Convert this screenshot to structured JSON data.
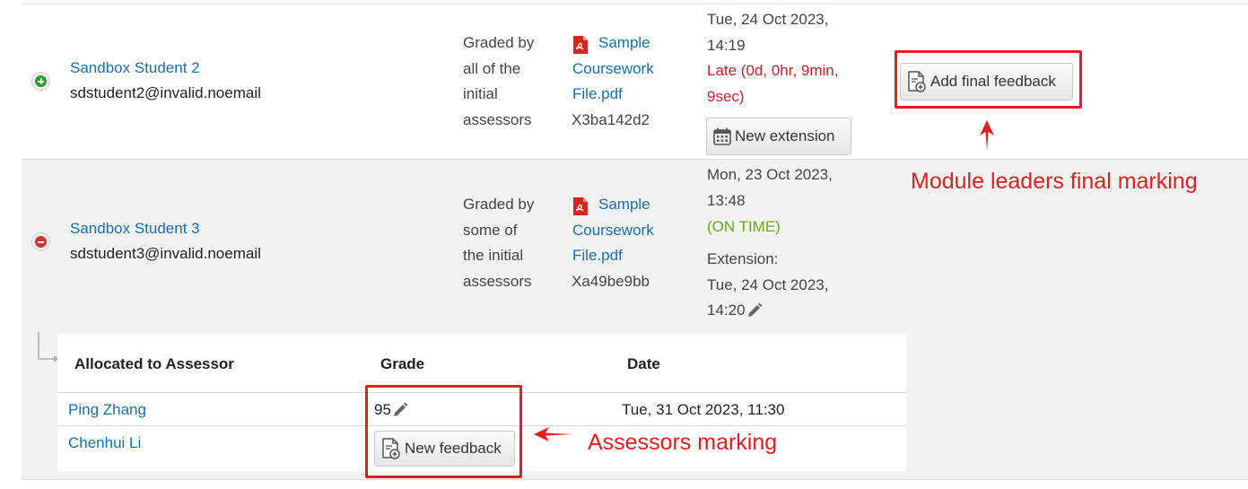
{
  "colors": {
    "link": "#1a6ea8",
    "late": "#c0242a",
    "on_time": "#6aa424",
    "annotation": "#e02020"
  },
  "rows": [
    {
      "toggle_icon": "expand-plus-icon",
      "student_name": "Sandbox Student 2",
      "student_email": "sdstudent2@invalid.noemail",
      "status_lines": [
        "Graded by",
        "all of the",
        "initial",
        "assessors"
      ],
      "file_lines": [
        "Sample",
        "Coursework",
        "File.pdf"
      ],
      "file_id": "X3ba142d2",
      "submitted_date": "Tue, 24 Oct 2023,",
      "submitted_time": "14:19",
      "timeliness_lines": [
        "Late (0d, 0hr, 9min,",
        "9sec)"
      ],
      "extension_button": "New extension",
      "final_feedback_button": "Add final feedback"
    },
    {
      "toggle_icon": "collapse-minus-icon",
      "student_name": "Sandbox Student 3",
      "student_email": "sdstudent3@invalid.noemail",
      "status_lines": [
        "Graded by",
        "some of",
        "the initial",
        "assessors"
      ],
      "file_lines": [
        "Sample",
        "Coursework",
        "File.pdf"
      ],
      "file_id": "Xa49be9bb",
      "submitted_date": "Mon, 23 Oct 2023,",
      "submitted_time": "13:48",
      "timeliness": "(ON TIME)",
      "extension_label": "Extension:",
      "extension_date": "Tue, 24 Oct 2023,",
      "extension_time": "14:20"
    }
  ],
  "assessor_table": {
    "headers": [
      "Allocated to Assessor",
      "Grade",
      "Date"
    ],
    "rows": [
      {
        "assessor": "Ping Zhang",
        "grade": "95",
        "date": "Tue, 31 Oct 2023, 11:30"
      },
      {
        "assessor": "Chenhui Li",
        "feedback_button": "New feedback"
      }
    ]
  },
  "annotations": {
    "final_marking": "Module leaders final marking",
    "assessor_marking": "Assessors marking"
  }
}
